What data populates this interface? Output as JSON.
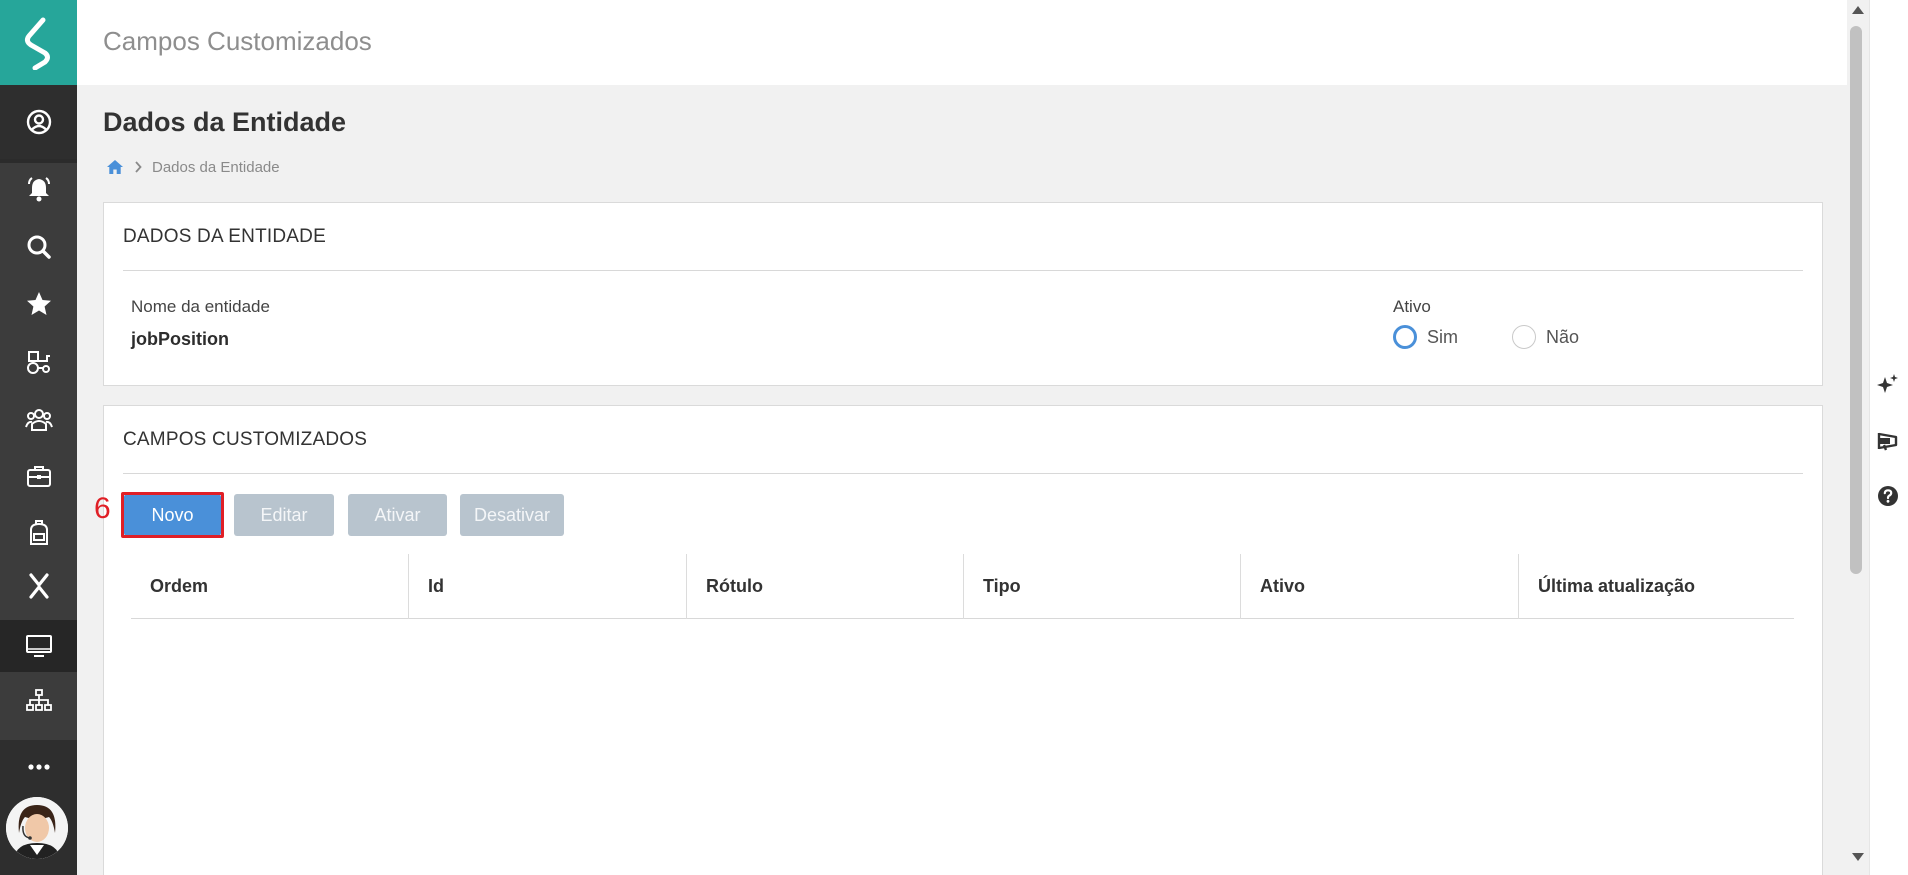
{
  "header": {
    "title": "Campos Customizados"
  },
  "page": {
    "title": "Dados da Entidade",
    "breadcrumb": {
      "current": "Dados da Entidade"
    }
  },
  "entity_panel": {
    "title": "DADOS DA ENTIDADE",
    "name_label": "Nome da entidade",
    "name_value": "jobPosition",
    "active_label": "Ativo",
    "active_options": [
      {
        "label": "Sim",
        "checked": true
      },
      {
        "label": "Não",
        "checked": false
      }
    ]
  },
  "custom_fields_panel": {
    "title": "CAMPOS CUSTOMIZADOS",
    "buttons": {
      "new": "Novo",
      "edit": "Editar",
      "activate": "Ativar",
      "deactivate": "Desativar"
    },
    "step_annotation": "6",
    "table": {
      "columns": [
        "Ordem",
        "Id",
        "Rótulo",
        "Tipo",
        "Ativo",
        "Última atualização"
      ],
      "rows": []
    }
  },
  "sidebar": {
    "items": [
      {
        "icon": "user-circle-icon"
      },
      {
        "icon": "bell-icon"
      },
      {
        "icon": "search-icon"
      },
      {
        "icon": "star-icon"
      },
      {
        "icon": "tractor-icon"
      },
      {
        "icon": "people-shield-icon"
      },
      {
        "icon": "briefcase-icon"
      },
      {
        "icon": "backpack-icon"
      },
      {
        "icon": "close-x-icon"
      },
      {
        "icon": "monitor-icon",
        "active": true
      },
      {
        "icon": "org-chart-icon"
      },
      {
        "icon": "more-dots-icon"
      }
    ]
  },
  "right_rail": {
    "items": [
      {
        "icon": "sparkle-icon"
      },
      {
        "icon": "megaphone-icon"
      },
      {
        "icon": "help-icon"
      }
    ]
  },
  "colors": {
    "brand_teal": "#26a69a",
    "sidebar_bg": "#3c3c3c",
    "primary_button": "#4a90d9",
    "disabled_button": "#b8c4ce",
    "annotation_red": "#e01f26"
  }
}
